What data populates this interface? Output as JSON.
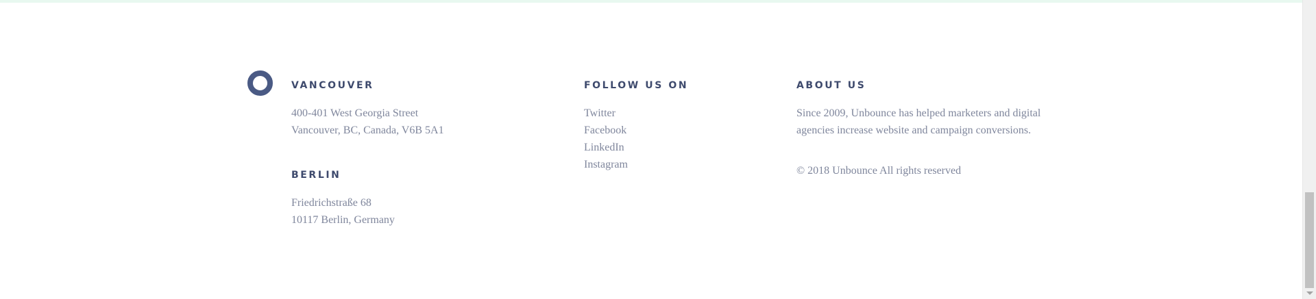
{
  "colors": {
    "heading": "#3e4a6d",
    "body_text": "#7f869c",
    "logo": "#4a5a84",
    "top_strip": "#e8f8f0"
  },
  "logo": {
    "icon": "ring-logo-icon"
  },
  "vancouver": {
    "heading": "VANCOUVER",
    "address_line1": "400-401 West Georgia Street",
    "address_line2": "Vancouver, BC, Canada, V6B 5A1"
  },
  "berlin": {
    "heading": "BERLIN",
    "address_line1": "Friedrichstraße 68",
    "address_line2": "10117 Berlin, Germany"
  },
  "follow": {
    "heading": "FOLLOW US ON",
    "links": [
      "Twitter",
      "Facebook",
      "LinkedIn",
      "Instagram"
    ]
  },
  "about": {
    "heading": "ABOUT US",
    "line1": "Since 2009, Unbounce has helped marketers and digital",
    "line2": "agencies increase website and campaign conversions.",
    "copyright": "© 2018 Unbounce All rights reserved"
  }
}
